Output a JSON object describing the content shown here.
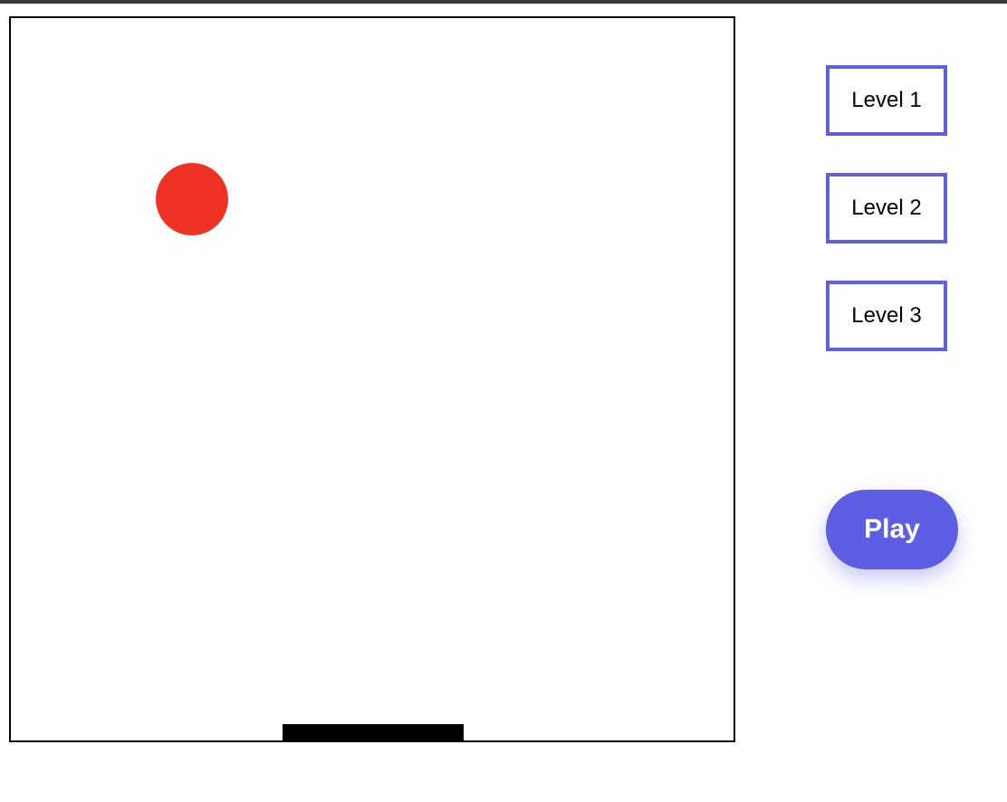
{
  "game": {
    "ball_color": "#ee3324",
    "paddle_color": "#000000",
    "board_border_color": "#000000"
  },
  "sidebar": {
    "levels": [
      {
        "label": "Level 1"
      },
      {
        "label": "Level 2"
      },
      {
        "label": "Level 3"
      }
    ],
    "level_border_color": "#6161e0",
    "play_label": "Play",
    "play_color": "#5e5ee5"
  }
}
